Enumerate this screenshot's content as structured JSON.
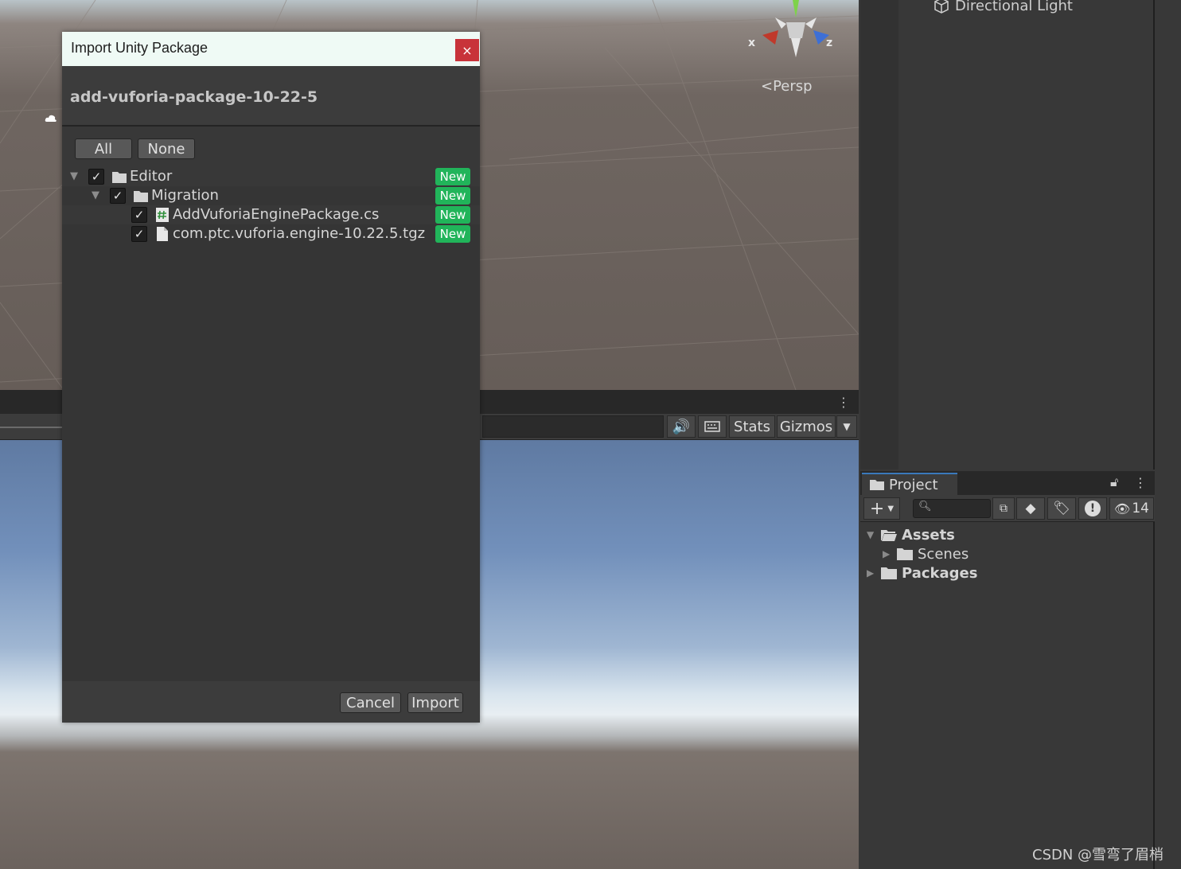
{
  "scene": {
    "persp_label": "Persp",
    "gizmo_x": "x",
    "gizmo_z": "z"
  },
  "game_toolbar": {
    "stats_label": "Stats",
    "gizmos_label": "Gizmos"
  },
  "hierarchy": {
    "item_label": "Directional Light"
  },
  "project": {
    "tab_label": "Project",
    "hidden_count": "14",
    "tree": [
      {
        "label": "Assets"
      },
      {
        "label": "Scenes"
      },
      {
        "label": "Packages"
      }
    ]
  },
  "dialog": {
    "title": "Import Unity Package",
    "close_glyph": "×",
    "package_name": "add-vuforia-package-10-22-5",
    "all_label": "All",
    "none_label": "None",
    "items": [
      {
        "label": "Editor",
        "badge": "New",
        "checked": true
      },
      {
        "label": "Migration",
        "badge": "New",
        "checked": true
      },
      {
        "label": "AddVuforiaEnginePackage.cs",
        "badge": "New",
        "checked": true
      },
      {
        "label": "com.ptc.vuforia.engine-10.22.5.tgz",
        "badge": "New",
        "checked": true
      }
    ],
    "cancel_label": "Cancel",
    "import_label": "Import"
  },
  "watermark": "CSDN @雪弯了眉梢",
  "colors": {
    "badge_green": "#21b45a",
    "close_red": "#c8333a",
    "tab_accent": "#3a79bb"
  }
}
